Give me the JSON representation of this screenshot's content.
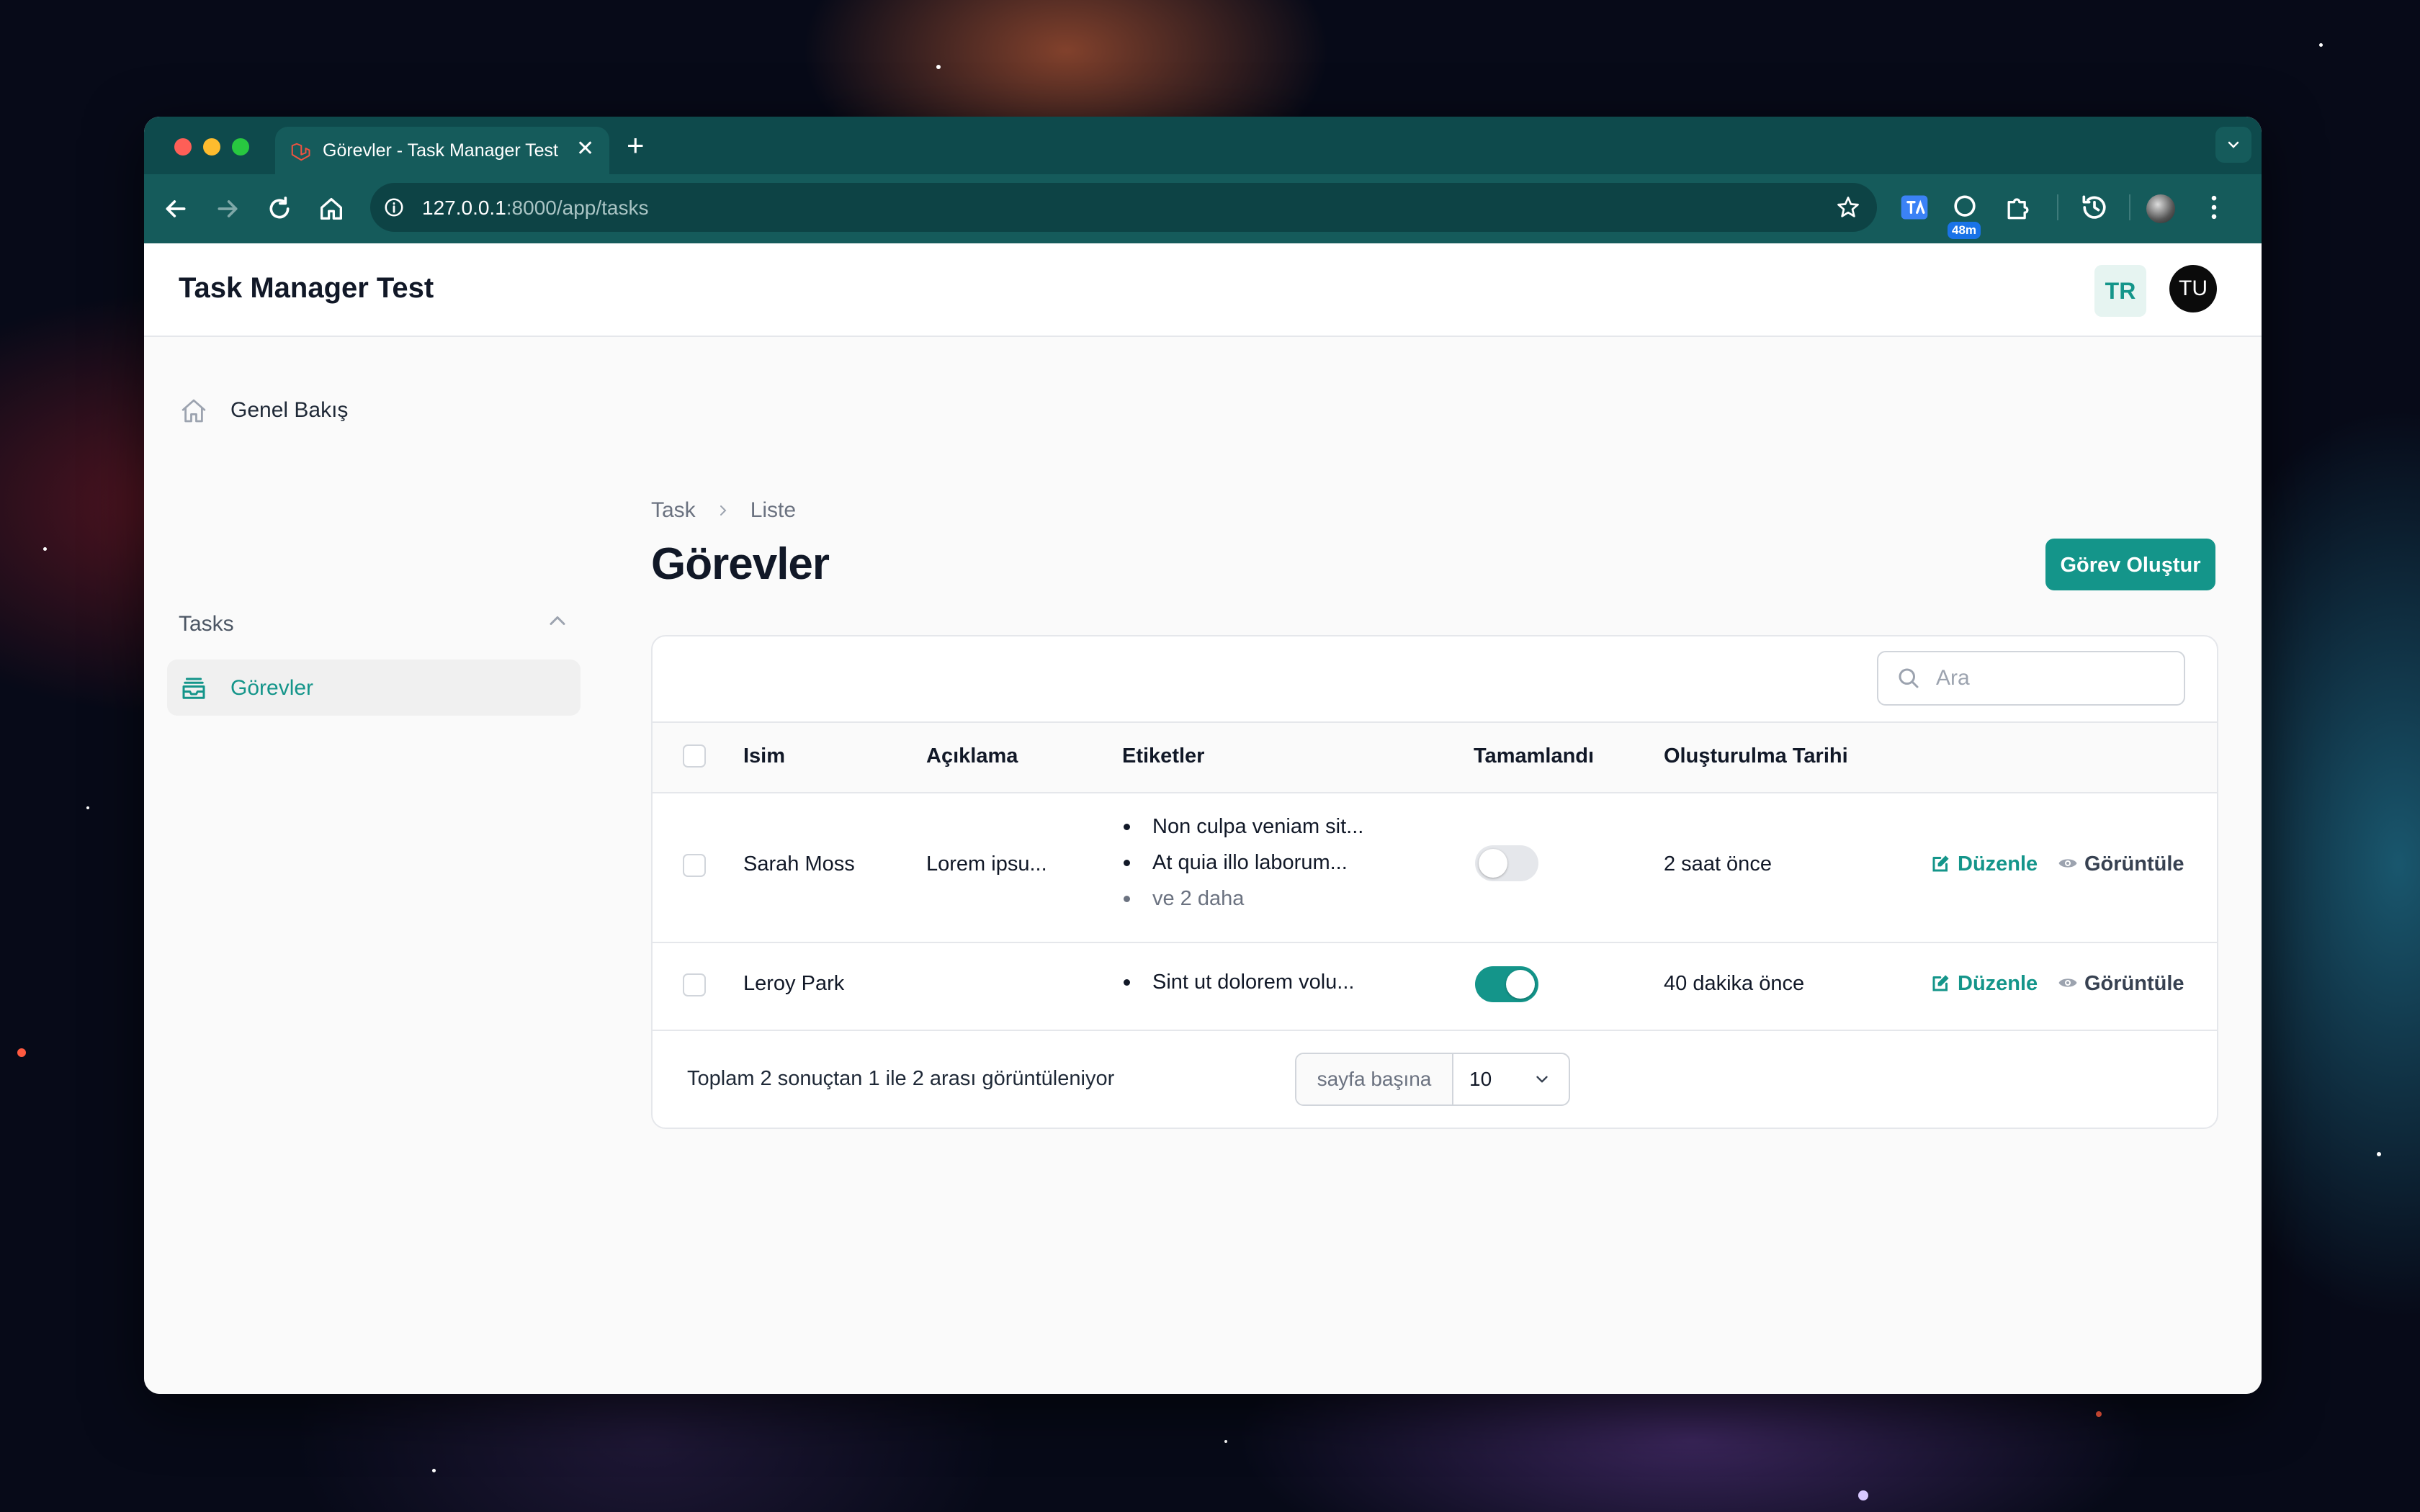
{
  "browser": {
    "tab_title": "Görevler - Task Manager Test",
    "url_host": "127.0.0.1",
    "url_path": ":8000/app/tasks",
    "extension_badge": "48m",
    "accent_color": "#155b5b"
  },
  "app": {
    "brand": "Task Manager Test",
    "language_button": "TR",
    "user_initials": "TU",
    "accent_color": "#14958a"
  },
  "sidebar": {
    "dashboard_label": "Genel Bakış",
    "group_label": "Tasks",
    "items": [
      {
        "label": "Görevler",
        "icon": "inbox-stack-icon",
        "active": true
      }
    ]
  },
  "page": {
    "breadcrumb": [
      "Task",
      "Liste"
    ],
    "title": "Görevler",
    "create_button": "Görev Oluştur"
  },
  "table": {
    "search_placeholder": "Ara",
    "columns": [
      "Isim",
      "Açıklama",
      "Etiketler",
      "Tamamlandı",
      "Oluşturulma Tarihi"
    ],
    "rows": [
      {
        "name": "Sarah Moss",
        "description": "Lorem ipsu...",
        "tags": [
          "Non culpa veniam sit...",
          "At quia illo laborum..."
        ],
        "more_tags": "ve 2 daha",
        "completed": false,
        "created": "2 saat önce",
        "edit_label": "Düzenle",
        "view_label": "Görüntüle"
      },
      {
        "name": "Leroy Park",
        "description": "",
        "tags": [
          "Sint ut dolorem volu..."
        ],
        "more_tags": "",
        "completed": true,
        "created": "40 dakika önce",
        "edit_label": "Düzenle",
        "view_label": "Görüntüle"
      }
    ],
    "footer_text": "Toplam 2 sonuçtan 1 ile 2 arası görüntüleniyor",
    "per_page_label": "sayfa başına",
    "per_page_value": "10"
  }
}
